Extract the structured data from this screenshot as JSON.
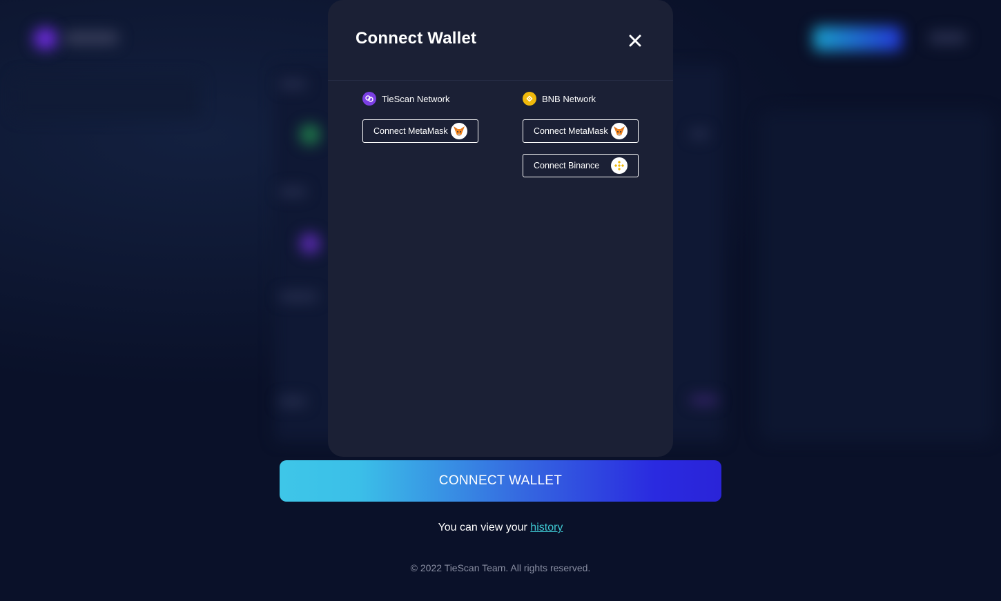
{
  "modal": {
    "title": "Connect Wallet",
    "close_icon": "close-icon"
  },
  "networks": [
    {
      "name": "TieScan Network",
      "icon": "tiescan-network-icon",
      "color": "#7b3fe4",
      "buttons": [
        {
          "label": "Connect MetaMask",
          "icon": "metamask-fox-icon"
        }
      ]
    },
    {
      "name": "BNB Network",
      "icon": "bnb-icon",
      "color": "#f0b90b",
      "buttons": [
        {
          "label": "Connect MetaMask",
          "icon": "metamask-fox-icon"
        },
        {
          "label": "Connect Binance",
          "icon": "binance-icon"
        }
      ]
    }
  ],
  "footer": {
    "connect_button": "CONNECT WALLET",
    "history_prefix": "You can view your",
    "history_link": "history",
    "copyright": "© 2022 TieScan Team. All rights reserved."
  },
  "colors": {
    "page_bg": "#0a1129",
    "modal_bg": "#1b2035",
    "gradient_start": "#3ec6e8",
    "gradient_end": "#2a24d8",
    "link": "#3ec6d0"
  }
}
